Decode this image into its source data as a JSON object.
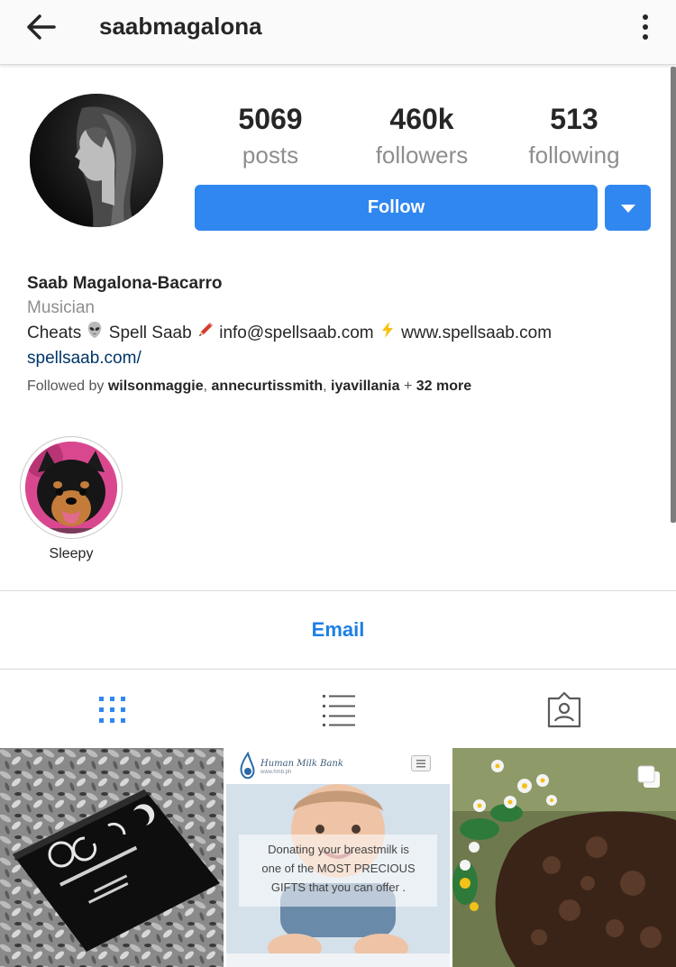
{
  "header": {
    "username": "saabmagalona"
  },
  "stats": {
    "posts": {
      "value": "5069",
      "label": "posts"
    },
    "followers": {
      "value": "460k",
      "label": "followers"
    },
    "following": {
      "value": "513",
      "label": "following"
    }
  },
  "actions": {
    "follow_label": "Follow"
  },
  "bio": {
    "full_name": "Saab Magalona-Bacarro",
    "category": "Musician",
    "line_parts": {
      "a": "Cheats",
      "b": "Spell Saab",
      "c": "info@spellsaab.com",
      "d": "www.spellsaab.com"
    },
    "website": "spellsaab.com/",
    "followed_by": {
      "prefix": "Followed by ",
      "user1": "wilsonmaggie",
      "sep1": ", ",
      "user2": "annecurtissmith",
      "sep2": ", ",
      "user3": "iyavillania",
      "sep3": " + ",
      "more": "32 more"
    }
  },
  "highlights": [
    {
      "label": "Sleepy"
    }
  ],
  "contact": {
    "email_label": "Email"
  },
  "tabs": [
    {
      "icon": "grid-icon",
      "active": true
    },
    {
      "icon": "list-icon",
      "active": false
    },
    {
      "icon": "tagged-icon",
      "active": false
    }
  ],
  "posts": [
    {
      "kind": "photo"
    },
    {
      "kind": "photo",
      "overlay_title": "Human Milk Bank",
      "overlay_subtitle": "www.hmb.ph",
      "overlay_line1": "Donating your breastmilk is",
      "overlay_line2": "one of the MOST PRECIOUS",
      "overlay_line3": "GIFTS that you can offer ."
    },
    {
      "kind": "carousel"
    }
  ],
  "colors": {
    "accent": "#2f87ef",
    "link": "#003569",
    "muted": "#8e8e8e"
  }
}
